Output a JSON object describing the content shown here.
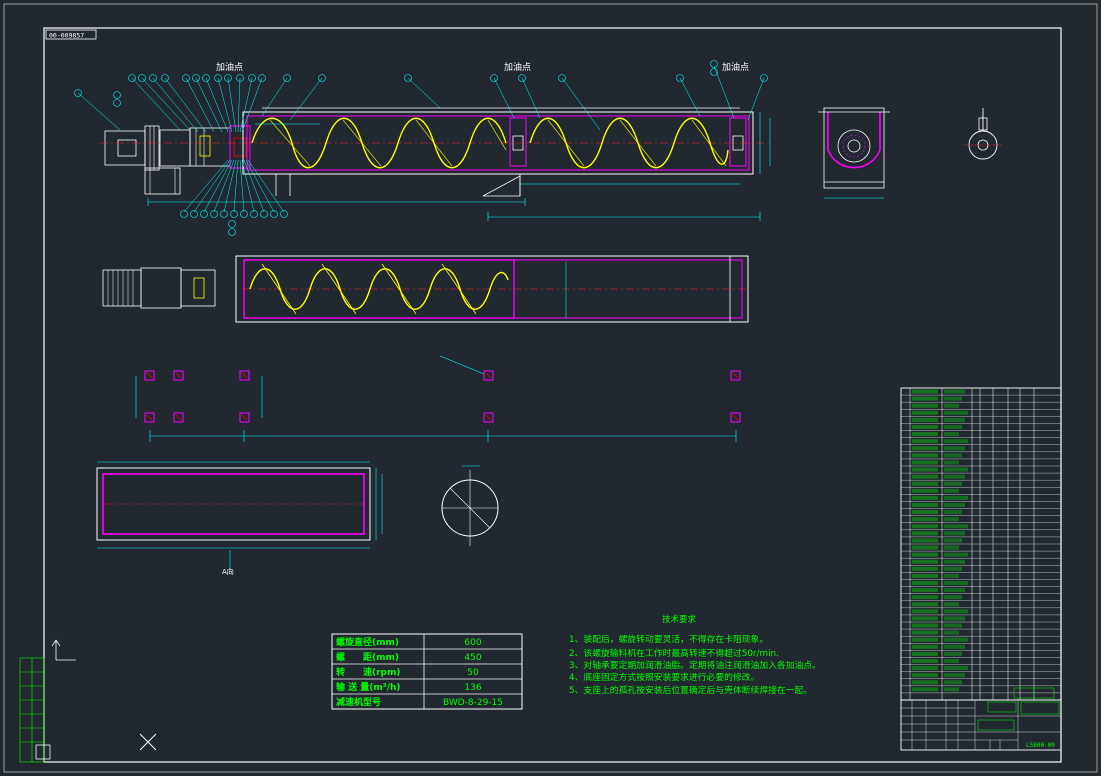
{
  "drawing": {
    "code_stamp": "00-009857",
    "title_block_code": "LS600-00",
    "note_section_title": "A向",
    "callout_label": "加油点"
  },
  "tech_requirements": {
    "title": "技术要求",
    "items": [
      "1、装配后，螺旋转动要灵活，不得存在卡阻现象。",
      "2、该螺旋输料机在工作时最高转速不得超过50r/min.",
      "3、对轴承要定期加润滑油脂。定期将油注润滑油加入各加油点。",
      "4、底座固定方式按照安装要求进行必要的修改。",
      "5、支座上的孤孔按安装后位置确定后与壳体断续焊接在一起。"
    ]
  },
  "spec_table": {
    "rows": [
      {
        "label": "螺旋直径(mm)",
        "value": "600"
      },
      {
        "label": "螺　　距(mm)",
        "value": "450"
      },
      {
        "label": "转　　速(rpm)",
        "value": "50"
      },
      {
        "label": "输 送 量(m³/h)",
        "value": "136"
      },
      {
        "label": "减速机型号",
        "value": "BWD-8-29-15"
      }
    ]
  },
  "colors": {
    "background": "#212830",
    "frame": "#ffffff",
    "structure": "#ff00ff",
    "helix": "#ffff00",
    "dimension": "#00ffff",
    "text": "#00ff00",
    "centerline": "#ff2020"
  }
}
